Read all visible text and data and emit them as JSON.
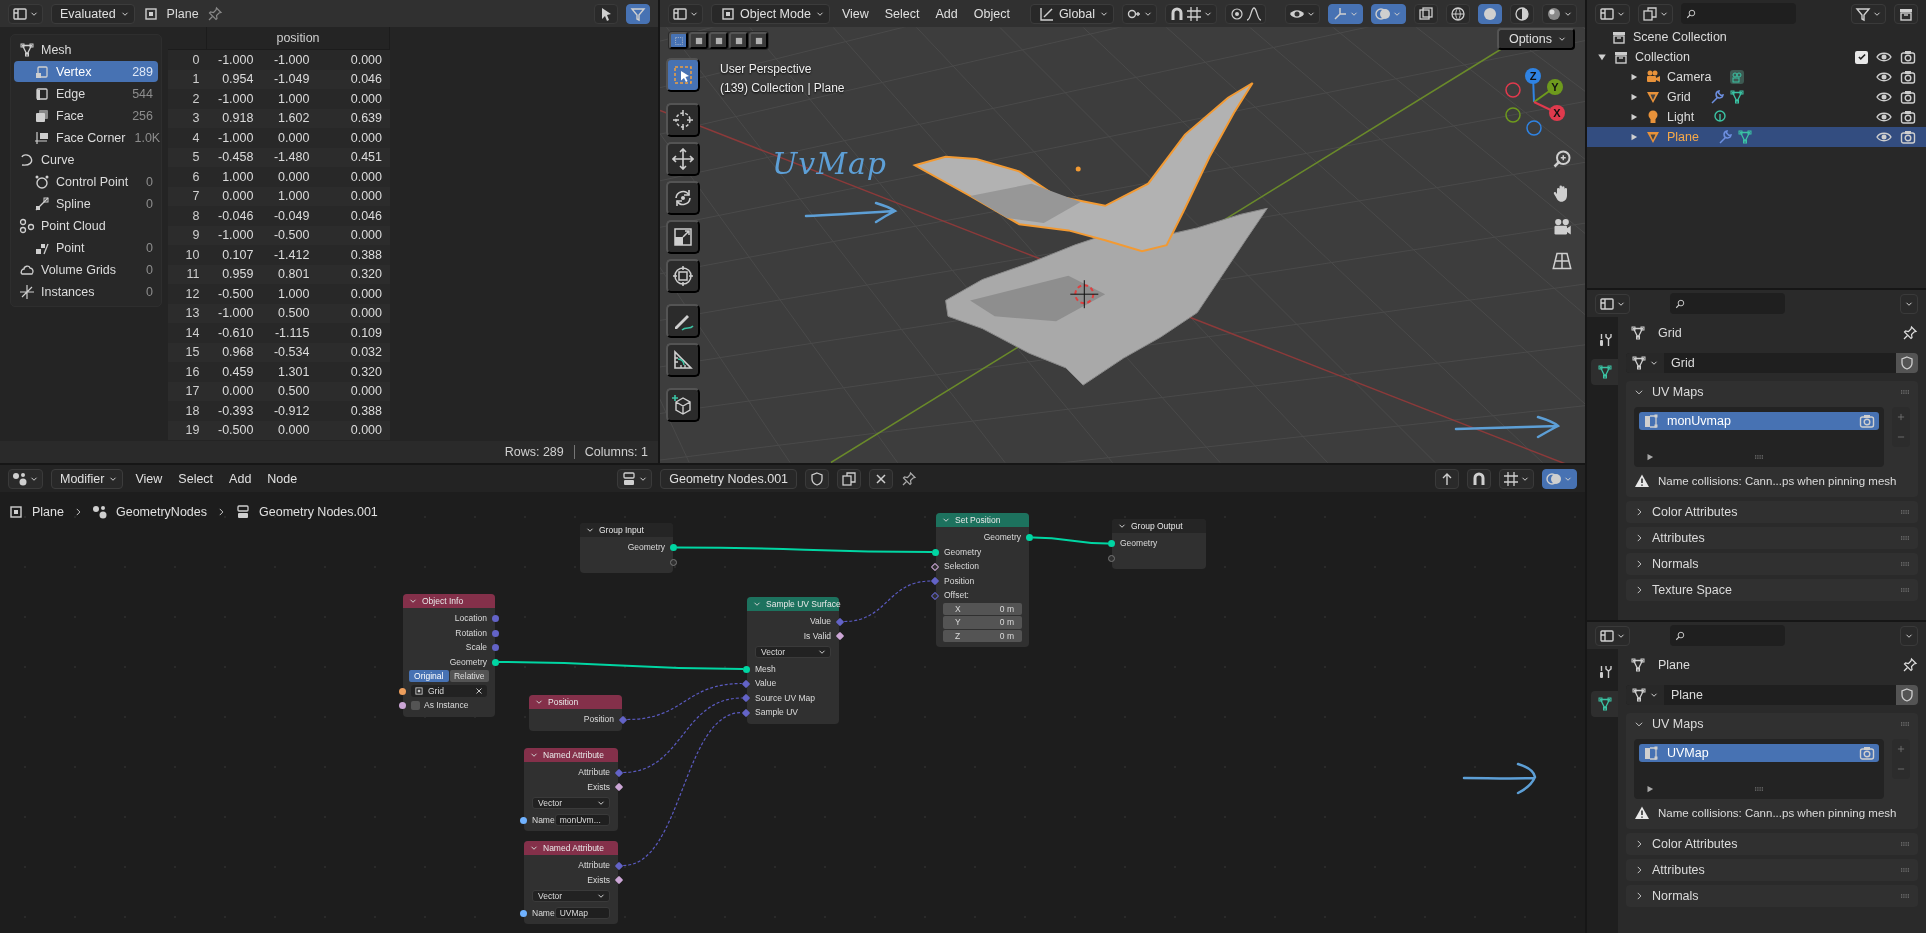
{
  "spreadsheet": {
    "header": {
      "mode": "Evaluated",
      "object": "Plane"
    },
    "domains": [
      {
        "kind": "mesh",
        "label": "Mesh",
        "selected": false,
        "children": [
          {
            "kind": "vertex",
            "label": "Vertex",
            "count": "289",
            "selected": true
          },
          {
            "kind": "edge",
            "label": "Edge",
            "count": "544",
            "selected": false
          },
          {
            "kind": "face",
            "label": "Face",
            "count": "256",
            "selected": false
          },
          {
            "kind": "corner",
            "label": "Face Corner",
            "count": "1.0K",
            "selected": false
          }
        ]
      },
      {
        "kind": "curve",
        "label": "Curve",
        "selected": false,
        "children": [
          {
            "kind": "control_point",
            "label": "Control Point",
            "count": "0",
            "selected": false
          },
          {
            "kind": "spline",
            "label": "Spline",
            "count": "0",
            "selected": false
          }
        ]
      },
      {
        "kind": "point_cloud",
        "label": "Point Cloud",
        "selected": false,
        "children": [
          {
            "kind": "point",
            "label": "Point",
            "count": "0",
            "selected": false
          }
        ]
      },
      {
        "kind": "volume",
        "label": "Volume Grids",
        "count": "0",
        "selected": false
      },
      {
        "kind": "instances",
        "label": "Instances",
        "count": "0",
        "selected": false
      }
    ],
    "column_header": "position",
    "rows": [
      {
        "index": "0",
        "values": [
          "-1.000",
          "-1.000",
          "0.000"
        ]
      },
      {
        "index": "1",
        "values": [
          "0.954",
          "-1.049",
          "0.046"
        ]
      },
      {
        "index": "2",
        "values": [
          "-1.000",
          "1.000",
          "0.000"
        ]
      },
      {
        "index": "3",
        "values": [
          "0.918",
          "1.602",
          "0.639"
        ]
      },
      {
        "index": "4",
        "values": [
          "-1.000",
          "0.000",
          "0.000"
        ]
      },
      {
        "index": "5",
        "values": [
          "-0.458",
          "-1.480",
          "0.451"
        ]
      },
      {
        "index": "6",
        "values": [
          "1.000",
          "0.000",
          "0.000"
        ]
      },
      {
        "index": "7",
        "values": [
          "0.000",
          "1.000",
          "0.000"
        ]
      },
      {
        "index": "8",
        "values": [
          "-0.046",
          "-0.049",
          "0.046"
        ]
      },
      {
        "index": "9",
        "values": [
          "-1.000",
          "-0.500",
          "0.000"
        ]
      },
      {
        "index": "10",
        "values": [
          "0.107",
          "-1.412",
          "0.388"
        ]
      },
      {
        "index": "11",
        "values": [
          "0.959",
          "0.801",
          "0.320"
        ]
      },
      {
        "index": "12",
        "values": [
          "-0.500",
          "1.000",
          "0.000"
        ]
      },
      {
        "index": "13",
        "values": [
          "-1.000",
          "0.500",
          "0.000"
        ]
      },
      {
        "index": "14",
        "values": [
          "-0.610",
          "-1.115",
          "0.109"
        ]
      },
      {
        "index": "15",
        "values": [
          "0.968",
          "-0.534",
          "0.032"
        ]
      },
      {
        "index": "16",
        "values": [
          "0.459",
          "1.301",
          "0.320"
        ]
      },
      {
        "index": "17",
        "values": [
          "0.000",
          "0.500",
          "0.000"
        ]
      },
      {
        "index": "18",
        "values": [
          "-0.393",
          "-0.912",
          "0.388"
        ]
      },
      {
        "index": "19",
        "values": [
          "-0.500",
          "0.000",
          "0.000"
        ]
      }
    ],
    "status": {
      "rows": "Rows: 289",
      "columns": "Columns: 1"
    }
  },
  "viewport": {
    "header": {
      "mode": "Object Mode",
      "menus": [
        "View",
        "Select",
        "Add",
        "Object"
      ],
      "orientation": "Global"
    },
    "select_modes": [
      {
        "selected": true
      },
      {
        "selected": false
      },
      {
        "selected": false
      },
      {
        "selected": false
      },
      {
        "selected": false
      }
    ],
    "options": "Options",
    "info": [
      "User Perspective",
      "(139) Collection | Plane"
    ],
    "tools": [
      {
        "kind": "select",
        "selected": true
      },
      {
        "kind": "cursor",
        "selected": false
      },
      {
        "kind": "move",
        "selected": false
      },
      {
        "kind": "rotate",
        "selected": false
      },
      {
        "kind": "scale",
        "selected": false
      },
      {
        "kind": "transform",
        "selected": false
      },
      {
        "kind": "annotate",
        "selected": false
      },
      {
        "kind": "measure",
        "selected": false
      },
      {
        "kind": "add_cube",
        "selected": false
      }
    ],
    "gizmo_axes": [
      "Z",
      "Y",
      "X"
    ],
    "annotation": "UvMap"
  },
  "node_editor": {
    "header": {
      "context": "Modifier",
      "menus": [
        "View",
        "Select",
        "Add",
        "Node"
      ],
      "node_group": "Geometry Nodes.001"
    },
    "breadcrumbs": [
      "Plane",
      "GeometryNodes",
      "Geometry Nodes.001"
    ],
    "nodes": [
      {
        "title": "Group Input",
        "kind": "group",
        "rows": [
          {
            "kind": "output",
            "label": "Geometry",
            "socket": {
              "kind": "geometry"
            }
          },
          {
            "kind": "output",
            "socket": {
              "kind": "empty"
            }
          }
        ]
      },
      {
        "title": "Object Info",
        "kind": "input",
        "rows": [
          {
            "kind": "output",
            "label": "Location",
            "socket": {
              "kind": "vector"
            }
          },
          {
            "kind": "output",
            "label": "Rotation",
            "socket": {
              "kind": "vector"
            }
          },
          {
            "kind": "output",
            "label": "Scale",
            "socket": {
              "kind": "vector"
            }
          },
          {
            "kind": "output",
            "label": "Geometry",
            "socket": {
              "kind": "geometry"
            }
          },
          {
            "kind": "toggle",
            "options": [
              {
                "label": "Original",
                "selected": true
              },
              {
                "label": "Relative",
                "selected": false
              }
            ]
          },
          {
            "kind": "object",
            "value": "Grid",
            "socket": {
              "kind": "object"
            }
          },
          {
            "kind": "checkbox",
            "label": "As Instance",
            "checked": false,
            "socket": {
              "kind": "boolean"
            }
          }
        ]
      },
      {
        "title": "Position",
        "kind": "input",
        "rows": [
          {
            "kind": "output",
            "label": "Position",
            "socket": {
              "kind": "vector_field"
            }
          }
        ]
      },
      {
        "title": "Named Attribute",
        "kind": "input",
        "rows": [
          {
            "kind": "output",
            "label": "Attribute",
            "socket": {
              "kind": "vector_field"
            }
          },
          {
            "kind": "output",
            "label": "Exists",
            "socket": {
              "kind": "boolean_field"
            }
          },
          {
            "kind": "dropdown",
            "value": "Vector"
          },
          {
            "kind": "text",
            "label": "Name",
            "value": "monUvm...",
            "socket": {
              "kind": "string"
            }
          }
        ]
      },
      {
        "title": "Named Attribute",
        "kind": "input",
        "rows": [
          {
            "kind": "output",
            "label": "Attribute",
            "socket": {
              "kind": "vector_field"
            }
          },
          {
            "kind": "output",
            "label": "Exists",
            "socket": {
              "kind": "boolean_field"
            }
          },
          {
            "kind": "dropdown",
            "value": "Vector"
          },
          {
            "kind": "text",
            "label": "Name",
            "value": "UVMap",
            "socket": {
              "kind": "string"
            }
          }
        ]
      },
      {
        "title": "Sample UV Surface",
        "kind": "geometry",
        "rows": [
          {
            "kind": "output",
            "label": "Value",
            "socket": {
              "kind": "vector_field"
            }
          },
          {
            "kind": "output",
            "label": "Is Valid",
            "socket": {
              "kind": "boolean_field"
            }
          },
          {
            "kind": "dropdown",
            "value": "Vector"
          },
          {
            "kind": "input",
            "label": "Mesh",
            "socket": {
              "kind": "geometry"
            }
          },
          {
            "kind": "input",
            "label": "Value",
            "socket": {
              "kind": "vector_field"
            }
          },
          {
            "kind": "input",
            "label": "Source UV Map",
            "socket": {
              "kind": "vector_field"
            }
          },
          {
            "kind": "input",
            "label": "Sample UV",
            "socket": {
              "kind": "vector_field"
            }
          }
        ]
      },
      {
        "title": "Set Position",
        "kind": "geometry",
        "rows": [
          {
            "kind": "output",
            "label": "Geometry",
            "socket": {
              "kind": "geometry"
            }
          },
          {
            "kind": "input",
            "label": "Geometry",
            "socket": {
              "kind": "geometry"
            }
          },
          {
            "kind": "input",
            "label": "Selection",
            "socket": {
              "kind": "boolean_hollow"
            }
          },
          {
            "kind": "input",
            "label": "Position",
            "socket": {
              "kind": "vector_field"
            }
          },
          {
            "kind": "input",
            "label": "Offset:",
            "socket": {
              "kind": "vector_hollow"
            }
          },
          {
            "kind": "vector",
            "components": [
              {
                "axis": "X",
                "value": "0 m"
              },
              {
                "axis": "Y",
                "value": "0 m"
              },
              {
                "axis": "Z",
                "value": "0 m"
              }
            ]
          }
        ]
      },
      {
        "title": "Group Output",
        "kind": "group",
        "rows": [
          {
            "kind": "input",
            "label": "Geometry",
            "socket": {
              "kind": "geometry"
            }
          },
          {
            "kind": "input",
            "socket": {
              "kind": "empty"
            }
          }
        ]
      }
    ]
  },
  "outliner": {
    "root": "Scene Collection",
    "items": [
      {
        "label": "Collection",
        "kind": "collection",
        "expanded": true,
        "checked": true,
        "selected": false,
        "children": [
          {
            "label": "Camera",
            "kind": "camera",
            "selected": false
          },
          {
            "label": "Grid",
            "kind": "mesh",
            "selected": false
          },
          {
            "label": "Light",
            "kind": "light",
            "selected": false
          },
          {
            "label": "Plane",
            "kind": "mesh",
            "selected": true
          }
        ]
      }
    ]
  },
  "properties": [
    {
      "tabs": [
        {
          "kind": "tool",
          "selected": false
        },
        {
          "kind": "data",
          "selected": true
        }
      ],
      "object": "Grid",
      "data": "Grid",
      "uv_maps": [
        {
          "label": "monUvmap",
          "selected": true
        }
      ],
      "warning": "Name collisions: Cann...ps when pinning mesh",
      "panels": [
        {
          "label": "UV Maps",
          "expanded": true
        },
        {
          "label": "Color Attributes",
          "expanded": false
        },
        {
          "label": "Attributes",
          "expanded": false
        },
        {
          "label": "Normals",
          "expanded": false
        },
        {
          "label": "Texture Space",
          "expanded": false
        }
      ]
    },
    {
      "tabs": [
        {
          "kind": "tool",
          "selected": false
        },
        {
          "kind": "data",
          "selected": true
        }
      ],
      "object": "Plane",
      "data": "Plane",
      "uv_maps": [
        {
          "label": "UVMap",
          "selected": true
        }
      ],
      "warning": "Name collisions: Cann...ps when pinning mesh",
      "panels": [
        {
          "label": "UV Maps",
          "expanded": true
        },
        {
          "label": "Color Attributes",
          "expanded": false
        },
        {
          "label": "Attributes",
          "expanded": false
        },
        {
          "label": "Normals",
          "expanded": false
        }
      ]
    }
  ]
}
